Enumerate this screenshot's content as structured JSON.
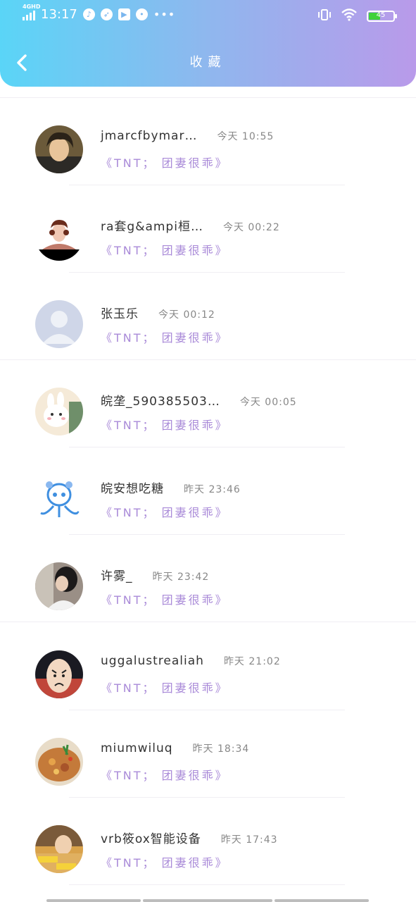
{
  "status_bar": {
    "network": "4GHD",
    "time": "13:17",
    "battery": "45"
  },
  "header": {
    "title": "收藏"
  },
  "items": [
    {
      "name": "jmarcfbymar…",
      "time": "今天  10:55",
      "tag": "《TNT； 团妻很乖》",
      "avatar": "photo-young-man"
    },
    {
      "name": "ra套g&ampi桓…",
      "time": "今天  00:22",
      "tag": "《TNT； 团妻很乖》",
      "avatar": "photo-woman"
    },
    {
      "name": "张玉乐",
      "time": "今天  00:12",
      "tag": "《TNT； 团妻很乖》",
      "avatar": "default-avatar"
    },
    {
      "name": "皖垄_590385503…",
      "time": "今天  00:05",
      "tag": "《TNT； 团妻很乖》",
      "avatar": "cartoon-rabbit"
    },
    {
      "name": "皖安想吃糖",
      "time": "昨天  23:46",
      "tag": "《TNT； 团妻很乖》",
      "avatar": "cartoon-doodle"
    },
    {
      "name": "许雾_",
      "time": "昨天  23:42",
      "tag": "《TNT； 团妻很乖》",
      "avatar": "photo-girl"
    },
    {
      "name": "uggalustrealiah",
      "time": "昨天  21:02",
      "tag": "《TNT； 团妻很乖》",
      "avatar": "sad-egg-face"
    },
    {
      "name": "miumwiluq",
      "time": "昨天  18:34",
      "tag": "《TNT； 团妻很乖》",
      "avatar": "food-dish"
    },
    {
      "name": "vrb筱ox智能设备",
      "time": "昨天  17:43",
      "tag": "《TNT； 团妻很乖》",
      "avatar": "photo-meme"
    }
  ]
}
